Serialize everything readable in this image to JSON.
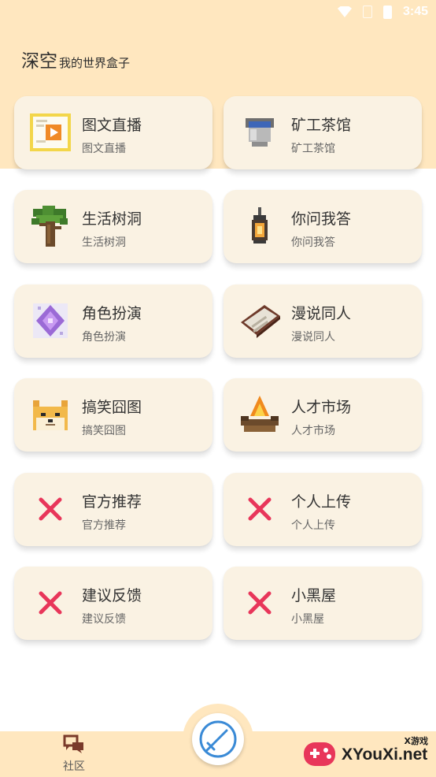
{
  "status_bar": {
    "time": "3:45"
  },
  "header": {
    "title": "深空",
    "subtitle": "我的世界盒子"
  },
  "cards": [
    {
      "name": "图文直播",
      "desc": "图文直播",
      "icon": "video-document-icon"
    },
    {
      "name": "矿工茶馆",
      "desc": "矿工茶馆",
      "icon": "water-bucket-icon"
    },
    {
      "name": "生活树洞",
      "desc": "生活树洞",
      "icon": "tree-icon"
    },
    {
      "name": "你问我答",
      "desc": "你问我答",
      "icon": "lantern-icon"
    },
    {
      "name": "角色扮演",
      "desc": "角色扮演",
      "icon": "purple-gem-icon"
    },
    {
      "name": "漫说同人",
      "desc": "漫说同人",
      "icon": "book-icon"
    },
    {
      "name": "搞笑囧图",
      "desc": "搞笑囧图",
      "icon": "doge-icon"
    },
    {
      "name": "人才市场",
      "desc": "人才市场",
      "icon": "campfire-icon"
    },
    {
      "name": "官方推荐",
      "desc": "官方推荐",
      "icon": "broken-image-x-icon"
    },
    {
      "name": "个人上传",
      "desc": "个人上传",
      "icon": "broken-image-x-icon"
    },
    {
      "name": "建议反馈",
      "desc": "建议反馈",
      "icon": "broken-image-x-icon"
    },
    {
      "name": "小黑屋",
      "desc": "小黑屋",
      "icon": "broken-image-x-icon"
    }
  ],
  "bottom_nav": {
    "community_label": "社区",
    "center_icon": "sword-icon"
  },
  "watermark": {
    "text": "XYouXi.net",
    "small": "X游戏"
  },
  "colors": {
    "band": "#ffe7bf",
    "card": "#faf2e3",
    "x_mark": "#e8365a"
  }
}
